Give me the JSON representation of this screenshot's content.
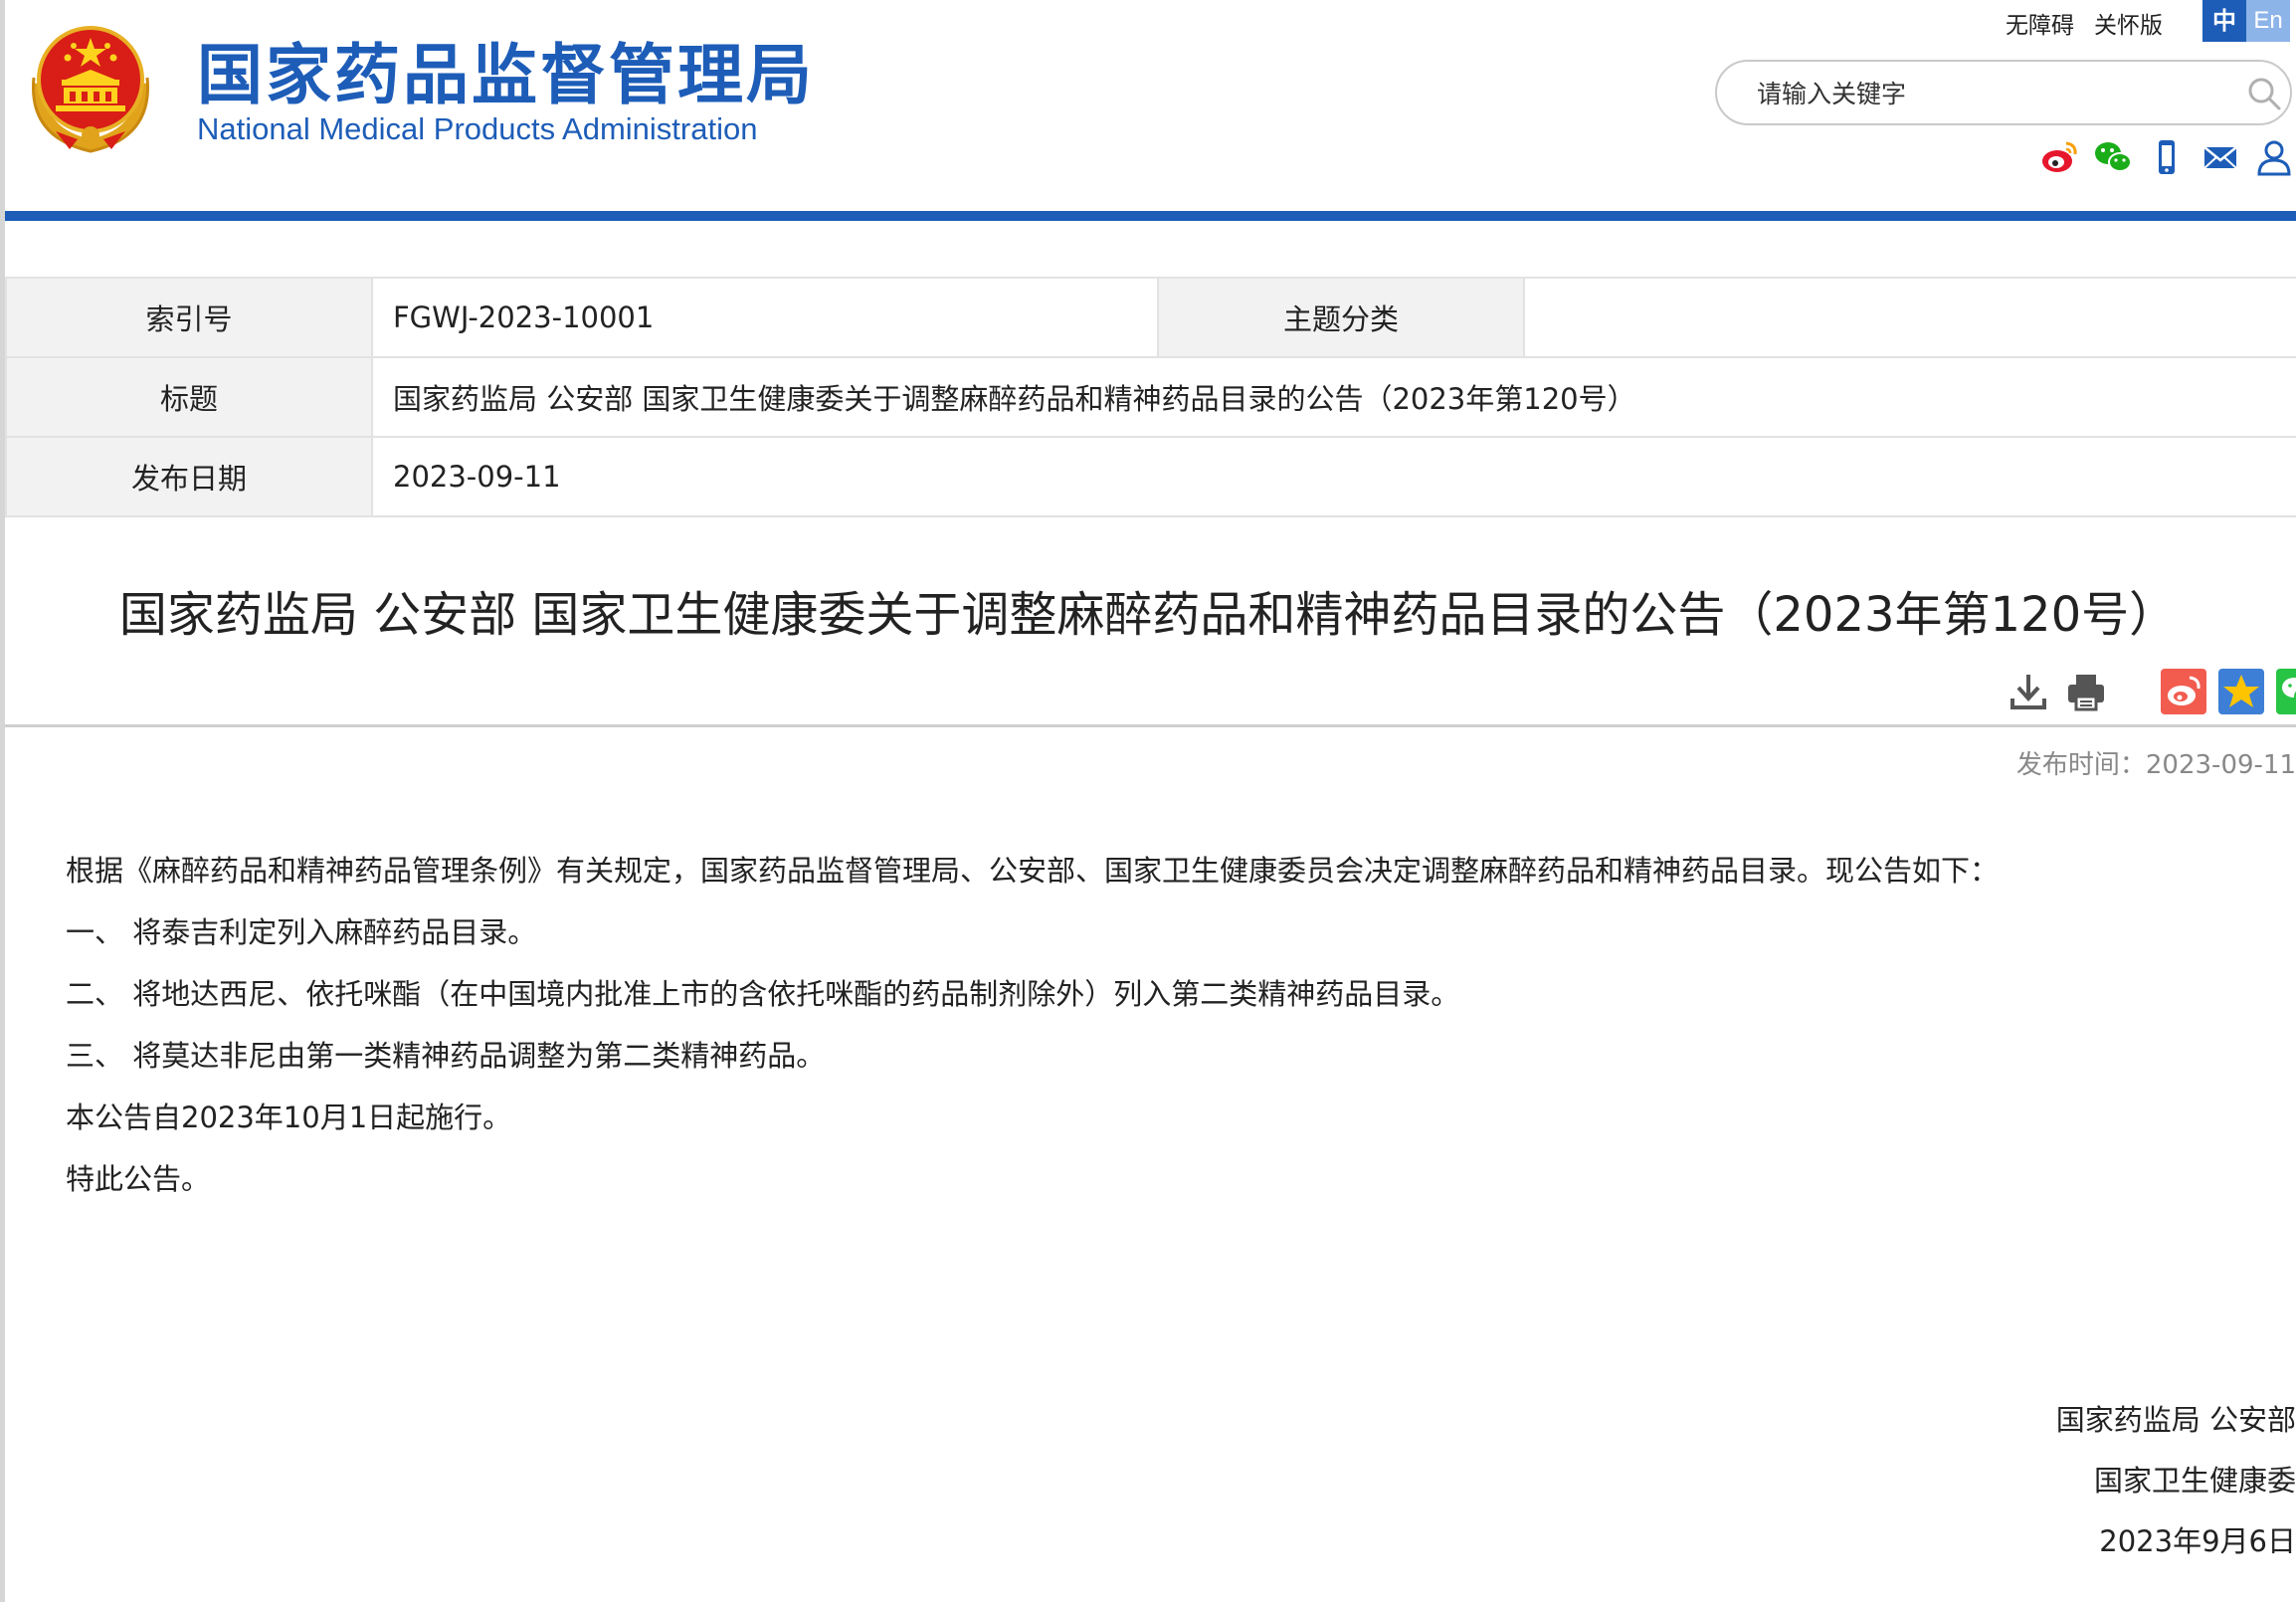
{
  "header": {
    "site_title_cn": "国家药品监督管理局",
    "site_title_en": "National Medical Products Administration",
    "top_links": [
      "无障碍",
      "关怀版"
    ],
    "lang": {
      "cn": "中",
      "en": "En"
    },
    "search": {
      "placeholder": "请输入关键字"
    },
    "social_icons": [
      "weibo-icon",
      "wechat-icon",
      "mobile-icon",
      "mail-icon",
      "user-icon"
    ],
    "brand_color": "#1d5db8"
  },
  "info_table": {
    "index_label": "索引号",
    "index_value": "FGWJ-2023-10001",
    "category_label": "主题分类",
    "category_value": "",
    "title_label": "标题",
    "title_value": "国家药监局 公安部 国家卫生健康委关于调整麻醉药品和精神药品目录的公告（2023年第120号）",
    "date_label": "发布日期",
    "date_value": "2023-09-11"
  },
  "article": {
    "title": "国家药监局 公安部 国家卫生健康委关于调整麻醉药品和精神药品目录的公告（2023年第120号）",
    "tools": [
      "download-icon",
      "print-icon",
      "share-weibo-icon",
      "favorite-icon",
      "share-wechat-icon"
    ],
    "publish_time": "发布时间：2023-09-11",
    "paragraphs": [
      "根据《麻醉药品和精神药品管理条例》有关规定，国家药品监督管理局、公安部、国家卫生健康委员会决定调整麻醉药品和精神药品目录。现公告如下：",
      "一、 将泰吉利定列入麻醉药品目录。",
      "二、 将地达西尼、依托咪酯（在中国境内批准上市的含依托咪酯的药品制剂除外）列入第二类精神药品目录。",
      "三、 将莫达非尼由第一类精神药品调整为第二类精神药品。",
      "本公告自2023年10月1日起施行。",
      "特此公告。"
    ],
    "signature": [
      "国家药监局 公安部",
      "国家卫生健康委",
      "2023年9月6日"
    ]
  }
}
